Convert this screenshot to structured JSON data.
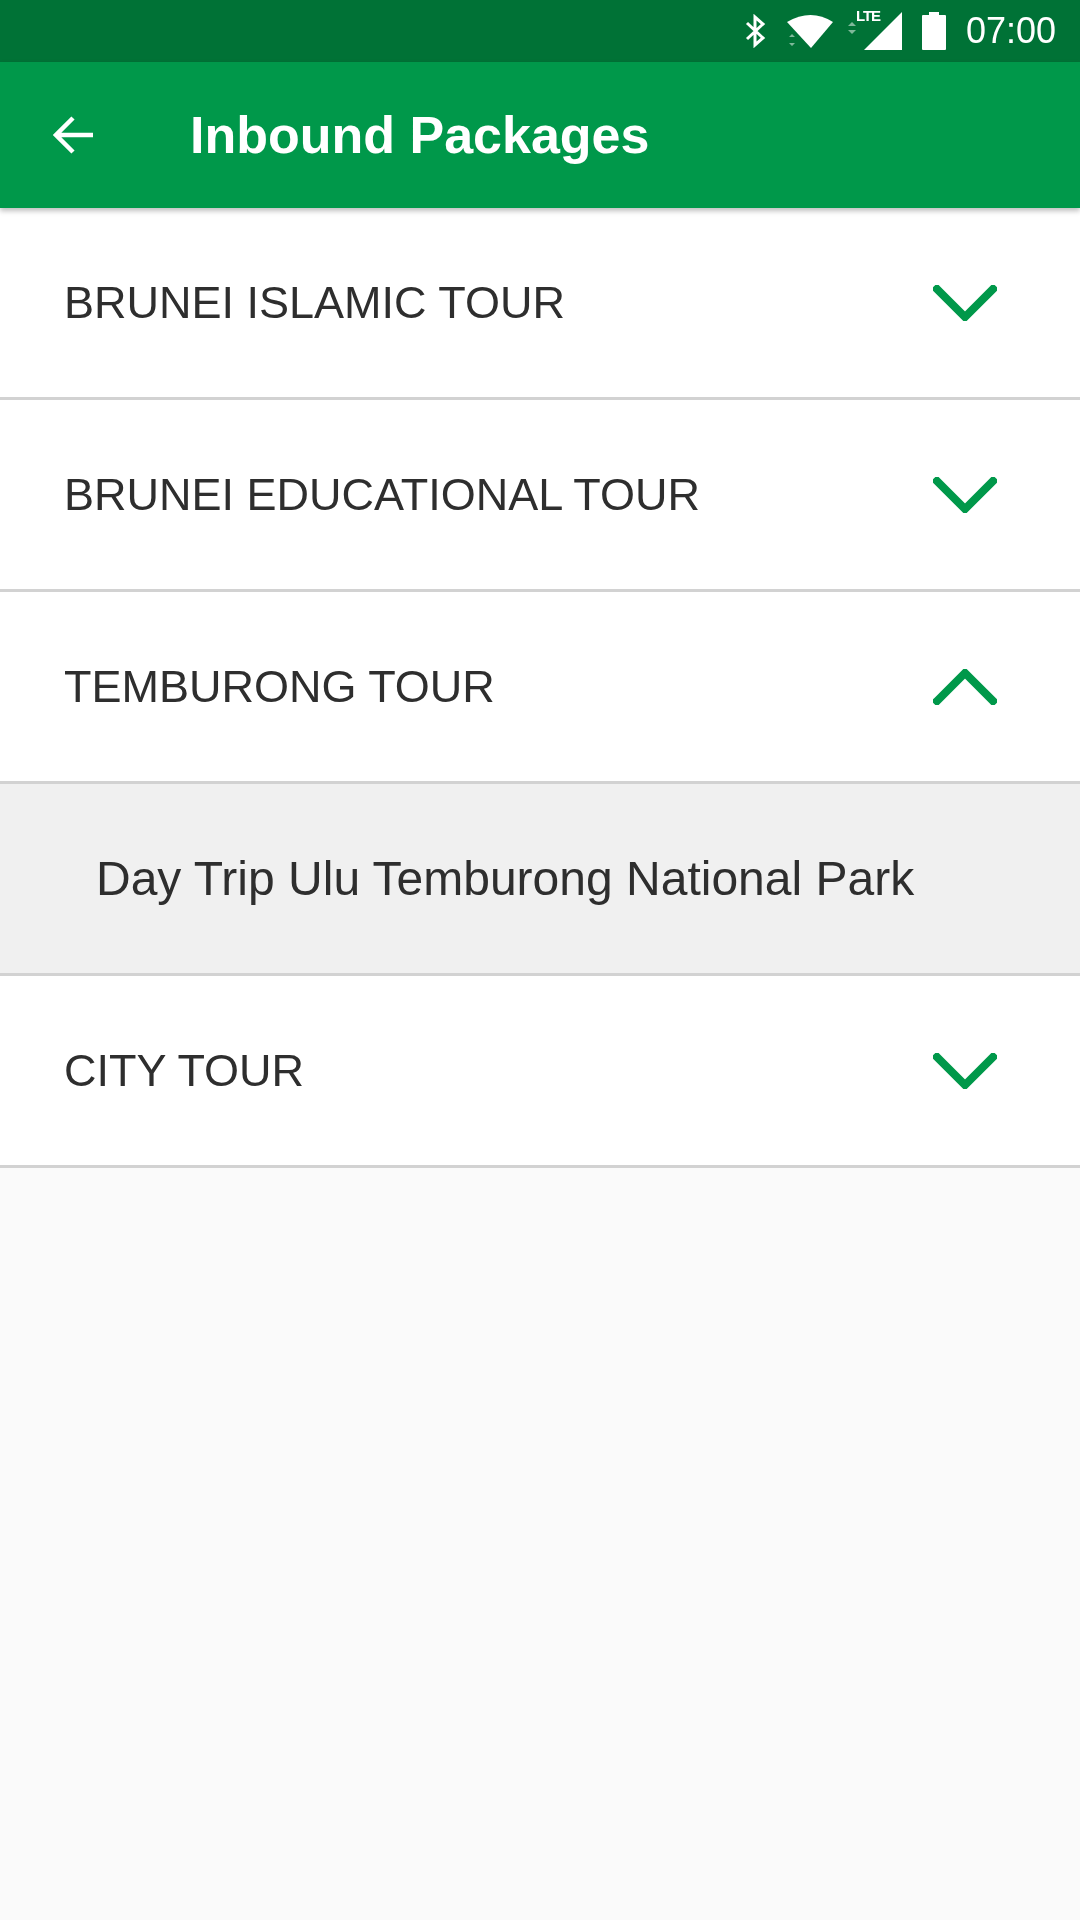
{
  "status_bar": {
    "network_type": "LTE",
    "time": "07:00"
  },
  "app_bar": {
    "title": "Inbound Packages"
  },
  "packages": [
    {
      "title": "BRUNEI ISLAMIC TOUR",
      "expanded": false
    },
    {
      "title": "BRUNEI EDUCATIONAL TOUR",
      "expanded": false
    },
    {
      "title": "TEMBURONG TOUR",
      "expanded": true,
      "children": [
        {
          "title": "Day Trip Ulu Temburong National Park"
        }
      ]
    },
    {
      "title": "CITY TOUR",
      "expanded": false
    }
  ]
}
